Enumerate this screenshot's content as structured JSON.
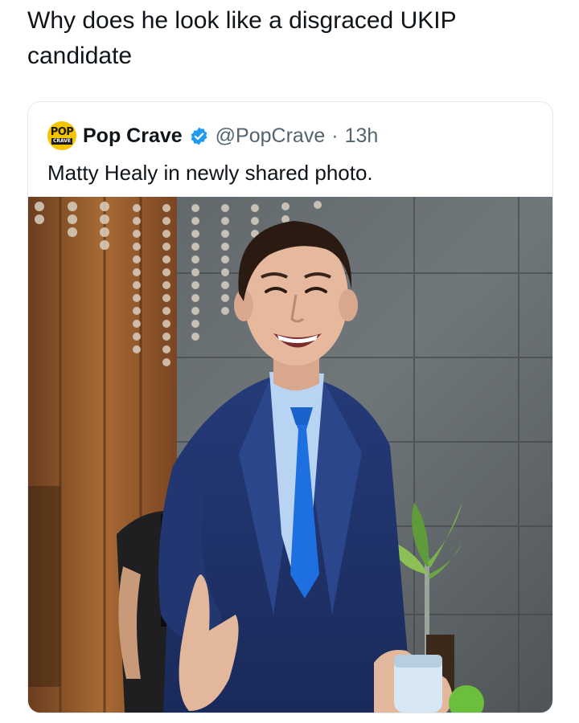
{
  "post": {
    "caption": "Why does he look like a disgraced UKIP candidate"
  },
  "quoted_tweet": {
    "display_name": "Pop Crave",
    "handle": "@PopCrave",
    "separator": "·",
    "time": "13h",
    "text": "Matty Healy in newly shared photo.",
    "avatar": {
      "line1": "POP",
      "line2": "CRAVE"
    },
    "verified_icon": "verified-badge-icon",
    "colors": {
      "verified": "#1d9bf0",
      "avatar_bg": "#f5c400",
      "muted_text": "#536471"
    }
  },
  "photo": {
    "subject": "man in navy suit with bright blue tie extending his hand"
  }
}
